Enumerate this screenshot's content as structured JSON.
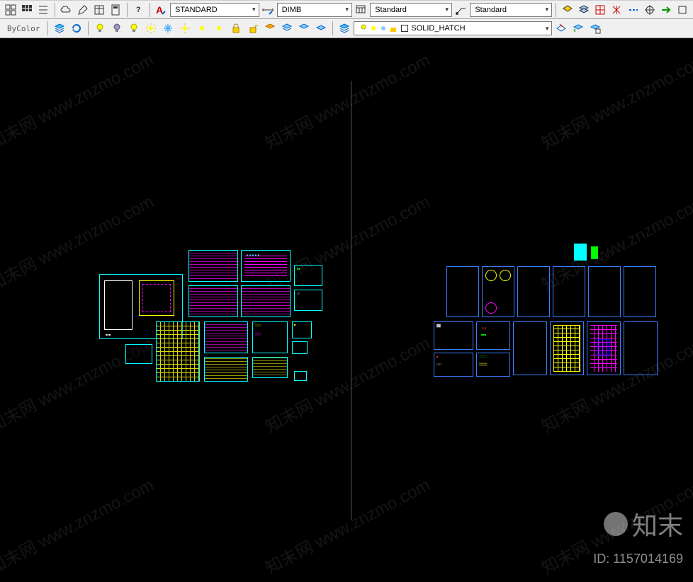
{
  "toolbar1": {
    "text_style": "STANDARD",
    "dim_style": "DIMB",
    "table_style": "Standard",
    "mleader_style": "Standard"
  },
  "toolbar2": {
    "bycolor_label": "ByColor",
    "layer_name": "SOLID_HATCH"
  },
  "watermark": {
    "url_text": "知末网 www.znzmo.com",
    "brand_text": "知末",
    "id_label": "ID: 1157014169"
  },
  "icons": {
    "help": "?",
    "grid": "grid-icon",
    "layers": "layers-icon",
    "bulb": "bulb-icon",
    "freeze": "freeze-icon",
    "lock": "lock-icon"
  },
  "colors": {
    "cyan": "#00ffff",
    "yellow": "#ffff00",
    "magenta": "#ff00ff",
    "blue": "#3a7fff",
    "green": "#00ff00",
    "red": "#ff3333"
  }
}
